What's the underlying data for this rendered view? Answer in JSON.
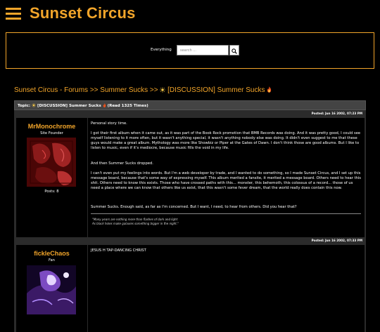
{
  "site": {
    "title": "Sunset Circus",
    "accent_color": "#f2a52a",
    "menu_icon": "hamburger-menu-icon"
  },
  "search": {
    "label": "Everything",
    "placeholder": "search ...",
    "button_icon": "search-icon"
  },
  "breadcrumb": {
    "items": [
      "Sunset Circus - Forums",
      "Summer Sucks",
      "[DISCUSSION] Summer Sucks"
    ],
    "separator": ">>"
  },
  "topic": {
    "label": "Topic:",
    "title": "[DISCUSSION] Summer Sucks",
    "reads": "(Read 1325 Times)"
  },
  "posts": [
    {
      "timestamp": "Posted: Jun 16 2002, 07:23 PM",
      "author": "MrMonochrome",
      "rank": "Site Founder",
      "post_count": "Posts: 8",
      "paragraphs": [
        "Personal story time.",
        "I got their first album when it came out, as it was part of the Book Rock promotion that BMB Records was doing. And it was pretty good, I could see myself listening to it more often, but it wasn't anything special, it wasn't anything nobody else was doing. It didn't even suggest to me that these guys would make a great album. Mythology was more like Showbiz or Piper at the Gates of Dawn. I don't think those are good albums. But I like to listen to music, even if it's mediocre, because music fills the void in my life.",
        "And then Summer Sucks dropped.",
        "I can't even put my feelings into words. But I'm a web developer by trade, and I wanted to do something, so I made Sunset Circus, and I set up this message board, because that's some way of expressing myself. This album merited a fansite, it merited a message board. Others need to hear this shit. Others need to know this exists. Those who have crossed paths with this... monster, this behemoth, this colossus of a record... those of us need a place where we can know that others like us exist, that this wasn't some fever dream, that the world really does contain this now.",
        "Summer Sucks. Enough said, as far as I'm concerned. But I want, I need, to hear from others. Did you hear that?"
      ],
      "signature": [
        "\"Many years are nothing more than flashes of dark and light",
        "As black holes make galaxies something bigger in the night.\""
      ]
    },
    {
      "timestamp": "Posted: Jun 16 2002, 07:33 PM",
      "author": "fickleChaos",
      "rank": "Fan",
      "paragraphs": [
        "JESUS H TAP-DANCING CHRIST"
      ]
    }
  ]
}
